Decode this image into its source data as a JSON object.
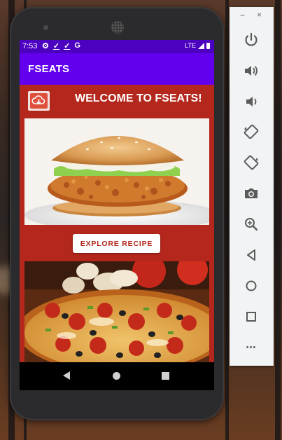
{
  "status_bar": {
    "time": "7:53",
    "left_icons": [
      "settings-icon",
      "check-download-icon",
      "check-download-icon",
      "google-icon"
    ],
    "google_letter": "G",
    "network": "LTE"
  },
  "app_bar": {
    "title": "FSEATS"
  },
  "main": {
    "welcome": "WELCOME TO FSEATS!",
    "explore_button": "EXPLORE RECIPE",
    "images": [
      "burger-photo",
      "pizza-photo"
    ]
  },
  "nav_bar": {
    "buttons": [
      "back",
      "home",
      "recents"
    ]
  },
  "emulator_panel": {
    "minimize": "−",
    "close": "×",
    "more": "•••",
    "controls": [
      "power",
      "volume-up",
      "volume-down",
      "rotate-left",
      "rotate-right",
      "screenshot",
      "zoom",
      "back",
      "home",
      "overview",
      "more"
    ]
  },
  "colors": {
    "status_bar": "#4c00c0",
    "app_bar": "#6200ee",
    "content_bg": "#b3271c",
    "button_text": "#b3271c"
  }
}
